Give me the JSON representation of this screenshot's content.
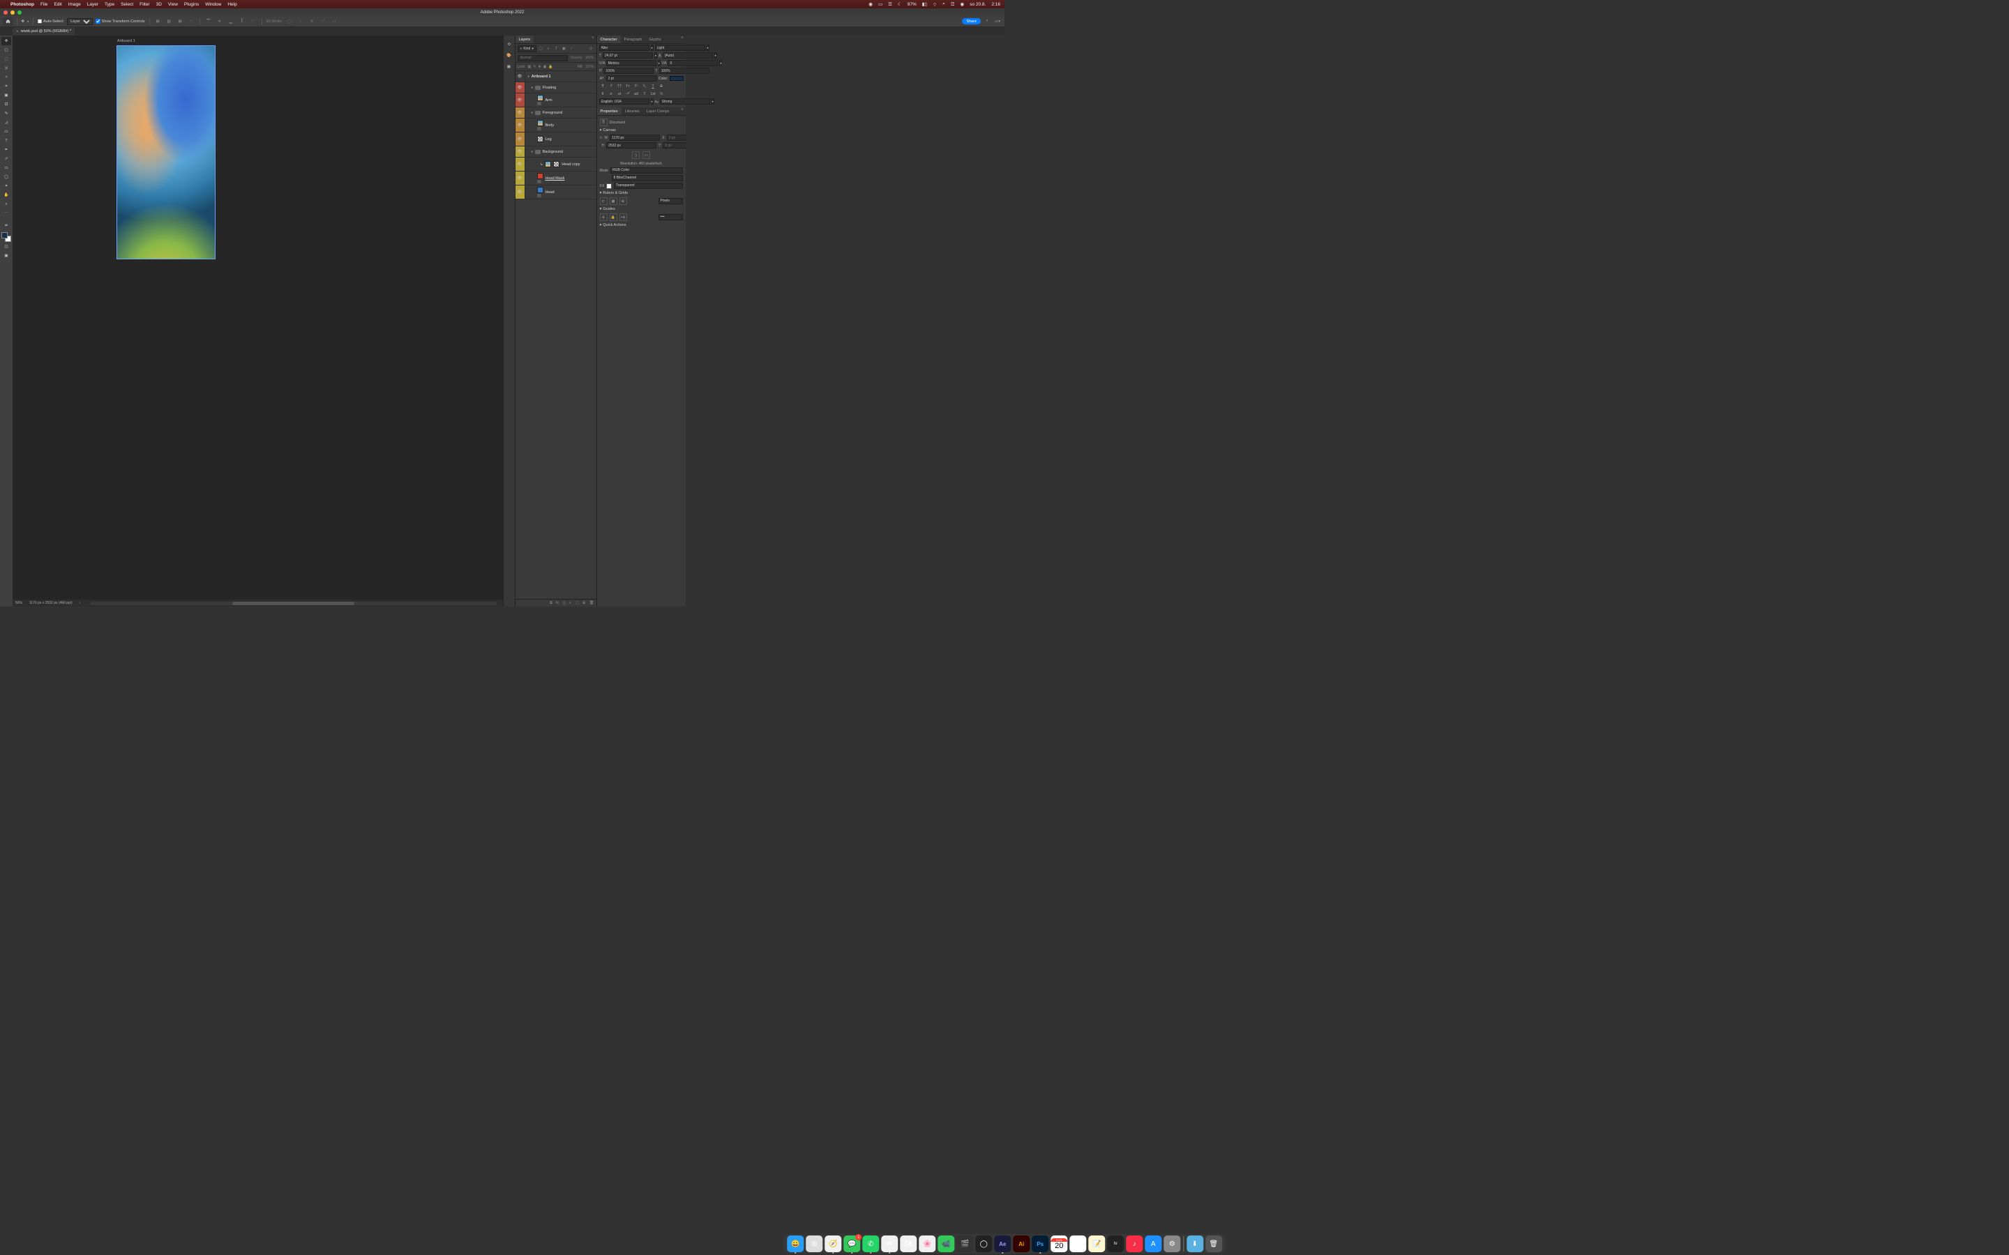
{
  "menubar": {
    "apple": "",
    "app": "Photoshop",
    "items": [
      "File",
      "Edit",
      "Image",
      "Layer",
      "Type",
      "Select",
      "Filter",
      "3D",
      "View",
      "Plugins",
      "Window",
      "Help"
    ],
    "battery_pct": "97%",
    "date": "so 20.8.",
    "time": "2:16"
  },
  "window": {
    "title": "Adobe Photoshop 2022"
  },
  "options": {
    "auto_select_label": "Auto-Select:",
    "auto_select_target": "Layer",
    "show_transform_label": "Show Transform Controls",
    "mode3d_label": "3D Mode:",
    "share_label": "Share"
  },
  "tab": {
    "label": "wwdc.psd @ 50% (RGB/8#) *"
  },
  "canvas": {
    "artboard_label": "Artboard 1",
    "zoom": "50%",
    "doc_info": "1170 px x 2532 px (460 ppi)"
  },
  "layers_panel": {
    "tabs": [
      "Layers"
    ],
    "kind_label": "Kind",
    "blend_mode": "Normal",
    "opacity_label": "Opacity:",
    "opacity_val": "100%",
    "lock_label": "Lock:",
    "fill_label": "Fill:",
    "fill_val": "100%",
    "rows": [
      {
        "type": "artboard",
        "name": "Artboard 1",
        "vis": "plain"
      },
      {
        "type": "group",
        "name": "Floating",
        "vis": "red",
        "indent": 1
      },
      {
        "type": "smart",
        "name": "Arm",
        "vis": "red",
        "indent": 2
      },
      {
        "type": "group",
        "name": "Foreground",
        "vis": "orange",
        "indent": 1
      },
      {
        "type": "smart",
        "name": "Body",
        "vis": "orange",
        "indent": 2
      },
      {
        "type": "layer",
        "name": "Leg",
        "vis": "orange",
        "indent": 2,
        "mask": true
      },
      {
        "type": "group",
        "name": "Background",
        "vis": "yellow",
        "indent": 1
      },
      {
        "type": "clip",
        "name": "Head copy",
        "vis": "yellow",
        "indent": 3
      },
      {
        "type": "smart",
        "name": "Head Mask",
        "vis": "yellow",
        "indent": 2,
        "underline": true,
        "red": true
      },
      {
        "type": "smart",
        "name": "Head",
        "vis": "yellow",
        "indent": 2,
        "blue": true
      }
    ]
  },
  "char_panel": {
    "tabs": [
      "Character",
      "Paragraph",
      "Glyphs"
    ],
    "font": "Aller",
    "style": "Light",
    "size": "24,67 pt",
    "leading": "(Auto)",
    "kerning": "Metrics",
    "tracking": "0",
    "hscale": "100%",
    "vscale": "100%",
    "baseline": "0 pt",
    "color_label": "Color:",
    "lang": "English: USA",
    "aa": "Strong"
  },
  "props_panel": {
    "tabs": [
      "Properties",
      "Libraries",
      "Layer Comps"
    ],
    "doc_label": "Document",
    "canvas_label": "Canvas",
    "w_label": "W",
    "w_val": "1170 px",
    "h_label": "H",
    "h_val": "2532 px",
    "x_label": "X",
    "x_ph": "0 px",
    "y_label": "Y",
    "y_ph": "0 px",
    "resolution": "Resolution: 460 pixels/inch",
    "mode_label": "Mode",
    "mode_val": "RGB Color",
    "depth_val": "8 Bits/Channel",
    "fill_label": "Fill",
    "fill_val": "Transparent",
    "rulers_label": "Rulers & Grids",
    "rulers_unit": "Pixels",
    "guides_label": "Guides",
    "quick_label": "Quick Actions"
  },
  "dock": {
    "apps": [
      {
        "name": "finder",
        "bg": "#2a9df4"
      },
      {
        "name": "launchpad",
        "bg": "linear-gradient(#888,#ccc)"
      },
      {
        "name": "safari",
        "bg": "#f0f0f0"
      },
      {
        "name": "messages",
        "bg": "#34c759",
        "badge": "1"
      },
      {
        "name": "whatsapp",
        "bg": "#25d366"
      },
      {
        "name": "mail",
        "bg": "#f0f0f0"
      },
      {
        "name": "maps",
        "bg": "#f0f0f0"
      },
      {
        "name": "photos",
        "bg": "#f0f0f0"
      },
      {
        "name": "facetime",
        "bg": "#34c759"
      },
      {
        "name": "fcp",
        "bg": "#333"
      },
      {
        "name": "c4d",
        "bg": "#222"
      },
      {
        "name": "ae",
        "bg": "#1a1a3a"
      },
      {
        "name": "ai",
        "bg": "#330000"
      },
      {
        "name": "ps",
        "bg": "#001e36"
      },
      {
        "name": "calendar",
        "bg": "#fff",
        "text": "20",
        "sub": "AUG"
      },
      {
        "name": "reminders",
        "bg": "#fff"
      },
      {
        "name": "notes",
        "bg": "#fff"
      },
      {
        "name": "tv",
        "bg": "#222"
      },
      {
        "name": "music",
        "bg": "#fa2d48"
      },
      {
        "name": "appstore",
        "bg": "#1e90ff"
      },
      {
        "name": "settings",
        "bg": "#888"
      }
    ]
  }
}
